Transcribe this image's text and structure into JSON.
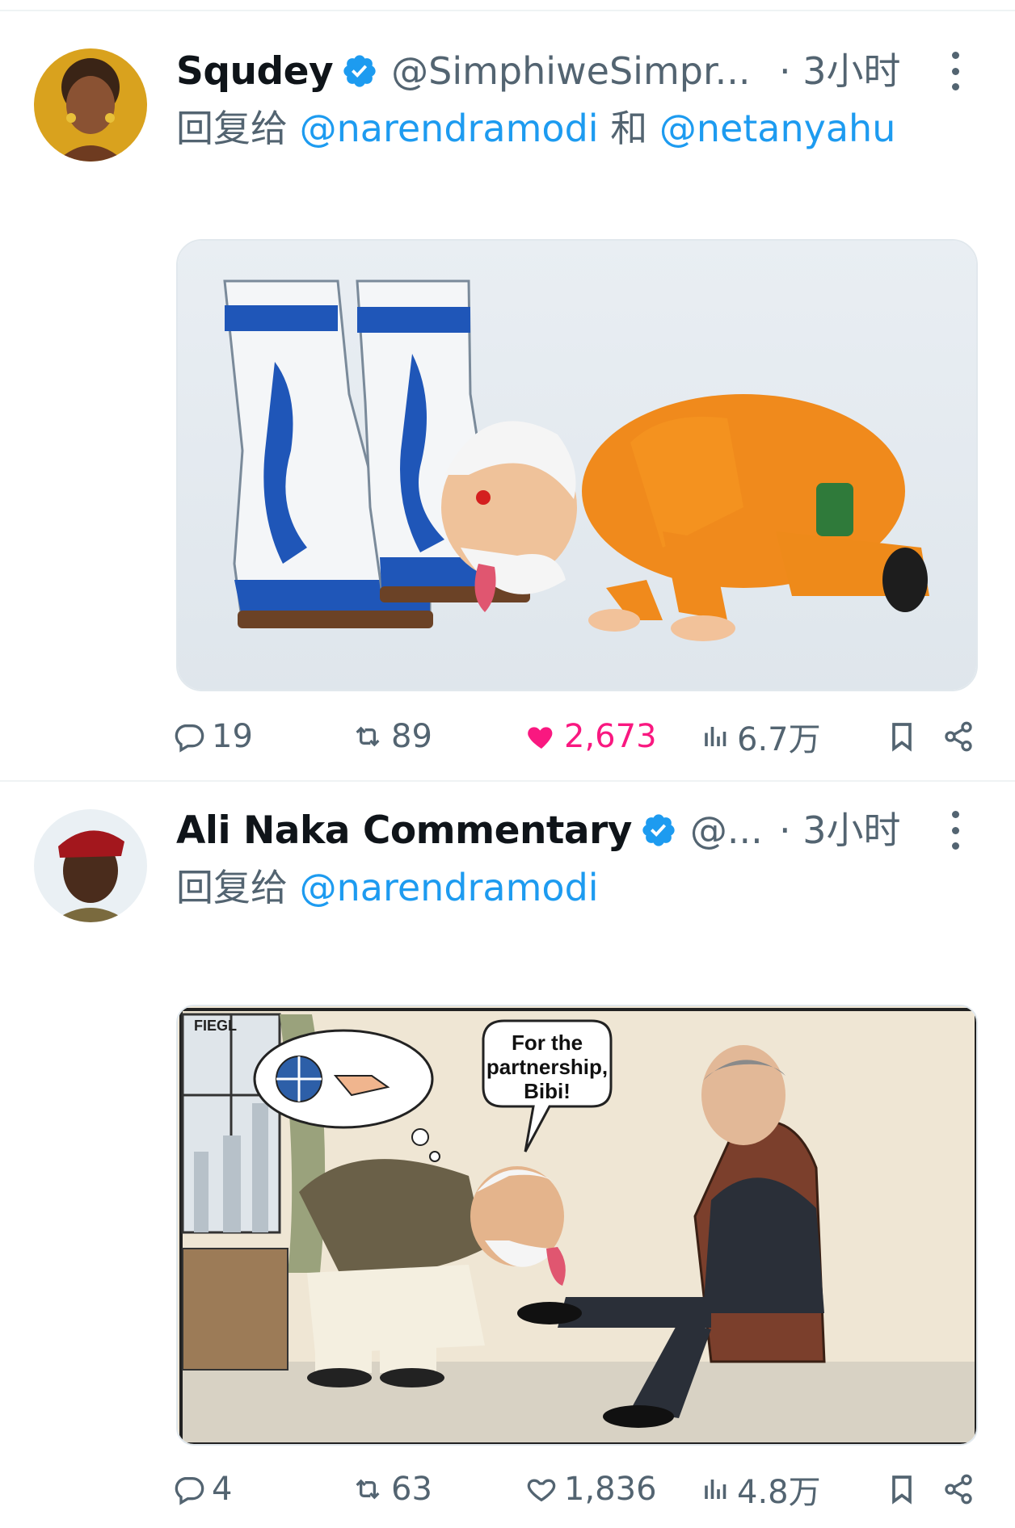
{
  "tweets": [
    {
      "name": "Squdey",
      "handle": "@SimphiweSimpr...",
      "time": "· 3小时",
      "reply_prefix": "回复给",
      "mentions": [
        "@narendramodi",
        "@netanyahu"
      ],
      "mention_join": "和",
      "media_alt": "Cartoon: a man in orange clothing licking blue-and-white boots",
      "stats": {
        "replies": "19",
        "retweets": "89",
        "likes": "2,673",
        "views": "6.7万"
      },
      "liked": true
    },
    {
      "name": "Ali Naka Commentary",
      "handle": "@...",
      "time": "· 3小时",
      "reply_prefix": "回复给",
      "mentions": [
        "@narendramodi"
      ],
      "media_alt": "Cartoon: a man bowing to lick the shoe of a seated man in a suit",
      "speech_bubble": [
        "For the",
        "partnership,",
        "Bibi!"
      ],
      "signature": "FIEGL",
      "stats": {
        "replies": "4",
        "retweets": "63",
        "likes": "1,836",
        "views": "4.8万"
      },
      "liked": false
    }
  ],
  "colors": {
    "accent": "#1d9bf0",
    "like": "#f91880",
    "muted": "#536471"
  },
  "icons": [
    "verified-badge-icon",
    "more-options-icon",
    "reply-icon",
    "retweet-icon",
    "like-icon",
    "views-icon",
    "bookmark-icon",
    "share-icon"
  ]
}
